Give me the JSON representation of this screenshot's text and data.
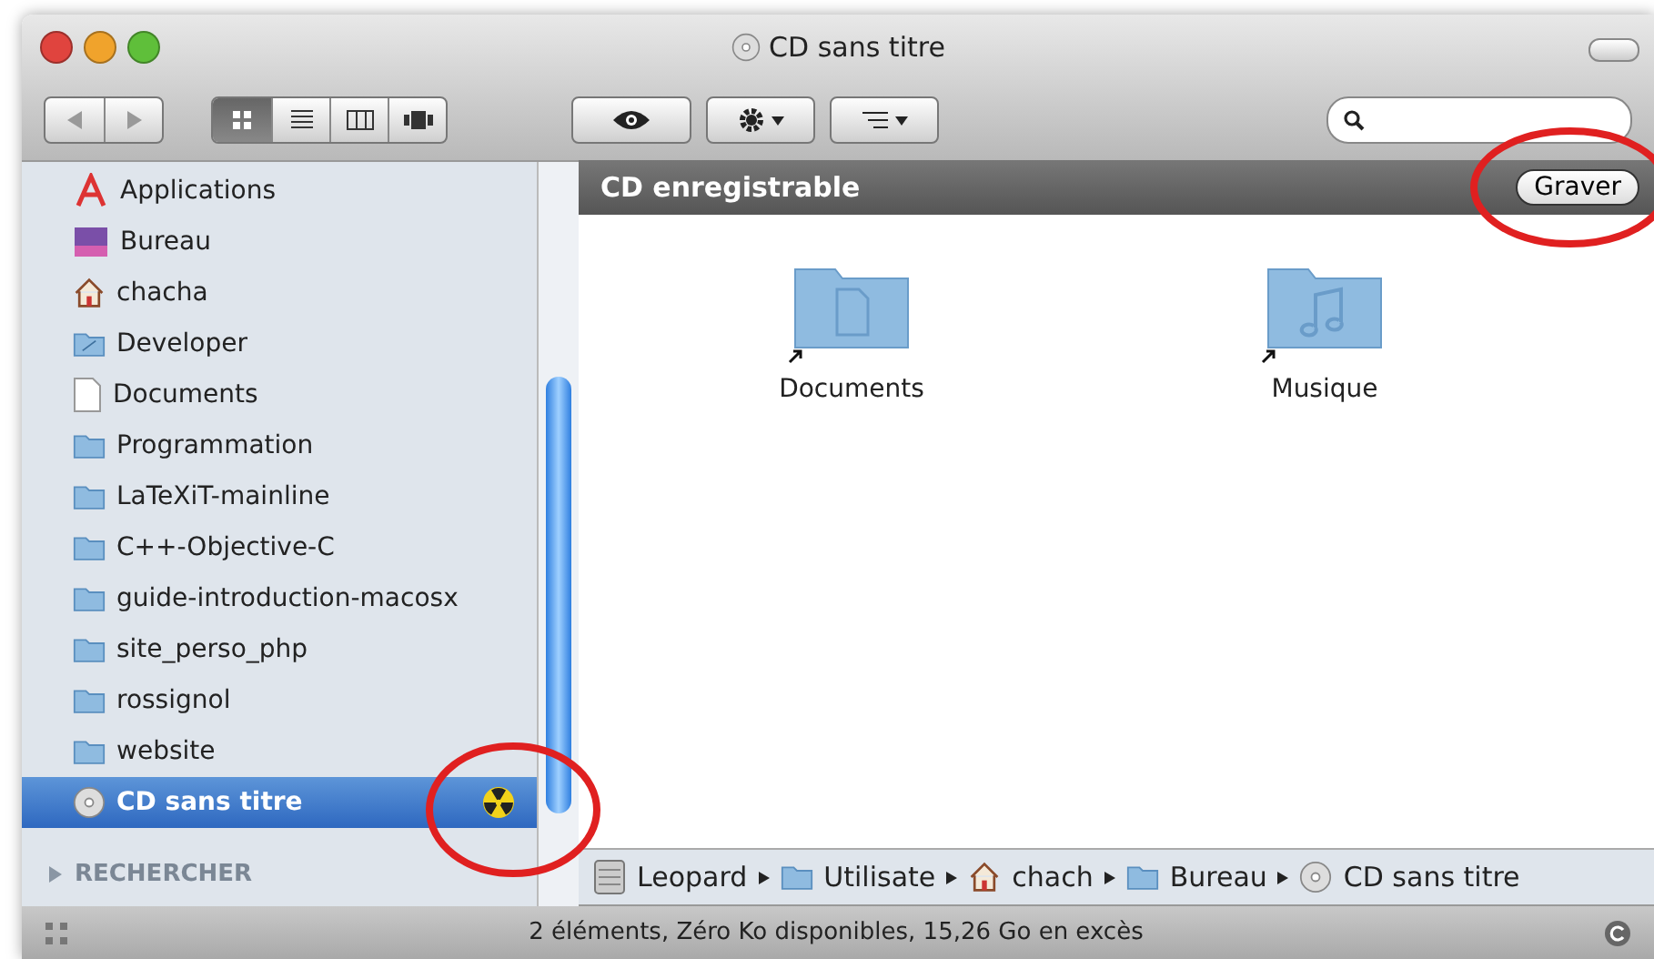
{
  "window": {
    "title": "CD sans titre"
  },
  "toolbar": {
    "views": [
      {
        "kind": "icons",
        "selected": true
      },
      {
        "kind": "list",
        "selected": false
      },
      {
        "kind": "columns",
        "selected": false
      },
      {
        "kind": "coverflow",
        "selected": false
      }
    ]
  },
  "sidebar": {
    "items": [
      {
        "label": "Applications",
        "kind": "apps",
        "selected": false
      },
      {
        "label": "Bureau",
        "kind": "desktop",
        "selected": false
      },
      {
        "label": "chacha",
        "kind": "home",
        "selected": false
      },
      {
        "label": "Developer",
        "kind": "devfolder",
        "selected": false
      },
      {
        "label": "Documents",
        "kind": "doc",
        "selected": false
      },
      {
        "label": "Programmation",
        "kind": "folder",
        "selected": false
      },
      {
        "label": "LaTeXiT-mainline",
        "kind": "folder",
        "selected": false
      },
      {
        "label": "C++-Objective-C",
        "kind": "folder",
        "selected": false
      },
      {
        "label": "guide-introduction-macosx",
        "kind": "folder",
        "selected": false
      },
      {
        "label": "site_perso_php",
        "kind": "folder",
        "selected": false
      },
      {
        "label": "rossignol",
        "kind": "folder",
        "selected": false
      },
      {
        "label": "website",
        "kind": "folder",
        "selected": false
      },
      {
        "label": "CD sans titre",
        "kind": "disc",
        "selected": true,
        "burn": true
      }
    ],
    "section": {
      "label": "RECHERCHER",
      "expanded": false
    }
  },
  "content": {
    "header": "CD enregistrable",
    "action": "Graver",
    "files": [
      {
        "label": "Documents",
        "kind": "doc"
      },
      {
        "label": "Musique",
        "kind": "music"
      }
    ]
  },
  "path_bar": [
    {
      "label": "Leopard",
      "kind": "drive"
    },
    {
      "label": "Utilisate",
      "kind": "folder"
    },
    {
      "label": "chach",
      "kind": "home"
    },
    {
      "label": "Bureau",
      "kind": "folder"
    },
    {
      "label": "CD sans titre",
      "kind": "disc"
    }
  ],
  "status_bar": "2 éléments, Zéro Ko disponibles, 15,26 Go en excès"
}
